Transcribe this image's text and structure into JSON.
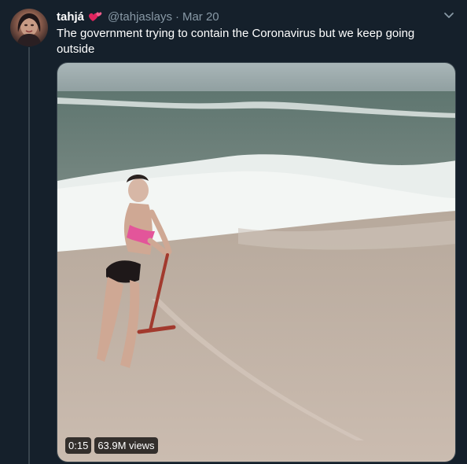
{
  "tweet": {
    "display_name": "tahjá",
    "handle": "@tahjaslays",
    "separator": "·",
    "date": "Mar 20",
    "text": "The government trying to contain the Coronavirus but we keep going outside",
    "emoji": "two-hearts-icon",
    "menu_icon": "chevron-down-icon"
  },
  "video": {
    "duration": "0:15",
    "views": "63.9M views"
  },
  "colors": {
    "background": "#15202b",
    "secondary_text": "#8899a6",
    "border": "#38444d",
    "heart": "#e0245e"
  }
}
